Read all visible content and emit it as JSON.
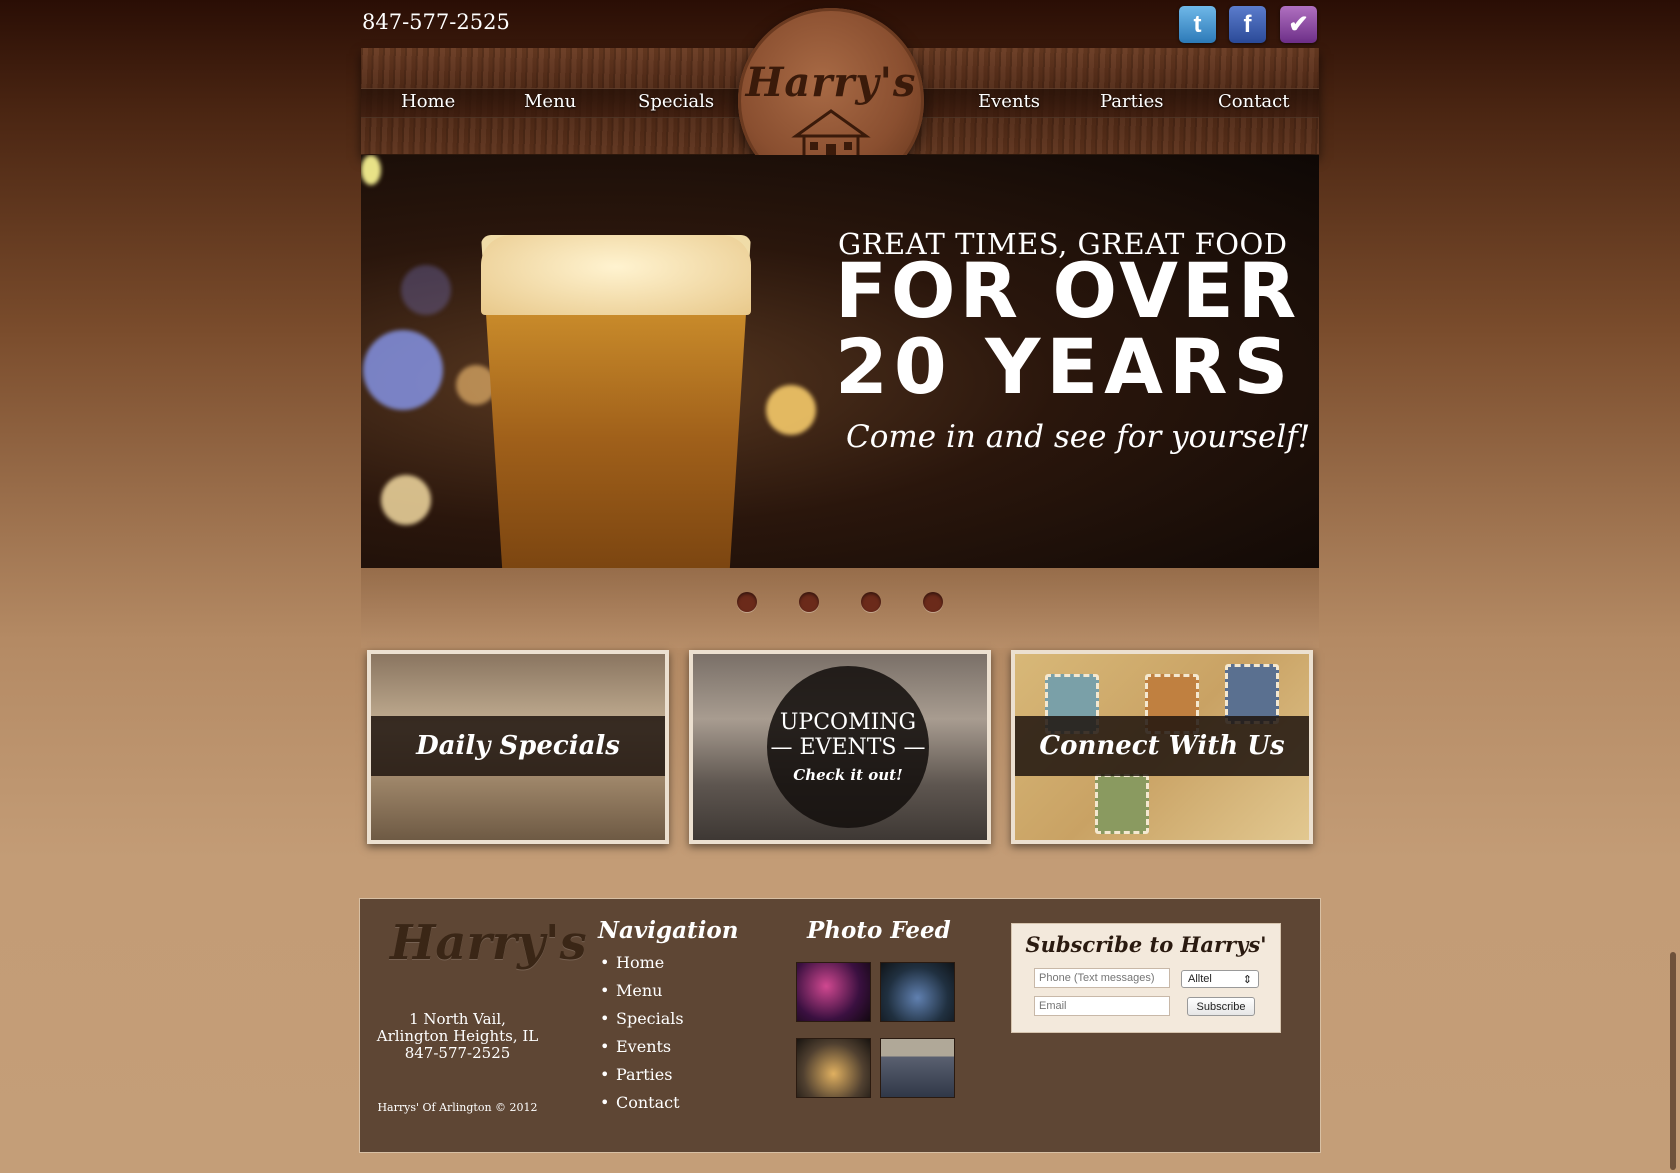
{
  "header": {
    "phone": "847-577-2525",
    "social": {
      "twitter_glyph": "t",
      "facebook_glyph": "f",
      "foursquare_glyph": "✔"
    },
    "logo_text": "Harry's"
  },
  "nav": {
    "left": [
      "Home",
      "Menu",
      "Specials"
    ],
    "right": [
      "Events",
      "Parties",
      "Contact"
    ]
  },
  "hero": {
    "line1": "GREAT TIMES, GREAT FOOD",
    "line2": "FOR OVER",
    "line3": "20 YEARS",
    "tagline": "Come in and see for yourself!",
    "slides_count": 4
  },
  "features": {
    "daily_specials": "Daily Specials",
    "events_line1": "UPCOMING",
    "events_line2": "— EVENTS —",
    "events_cta": "Check it out!",
    "connect": "Connect With Us"
  },
  "footer": {
    "logo_text": "Harry's",
    "address_line1": "1 North Vail,",
    "address_line2": "Arlington Heights, IL",
    "phone": "847-577-2525",
    "copyright": "Harrys' Of Arlington © 2012",
    "navigation_heading": "Navigation",
    "navigation_items": [
      "Home",
      "Menu",
      "Specials",
      "Events",
      "Parties",
      "Contact"
    ],
    "photo_feed_heading": "Photo Feed",
    "subscribe": {
      "title": "Subscribe to Harrys'",
      "phone_placeholder": "Phone (Text messages)",
      "carrier_selected": "Alltel",
      "email_placeholder": "Email",
      "button_label": "Subscribe"
    }
  }
}
